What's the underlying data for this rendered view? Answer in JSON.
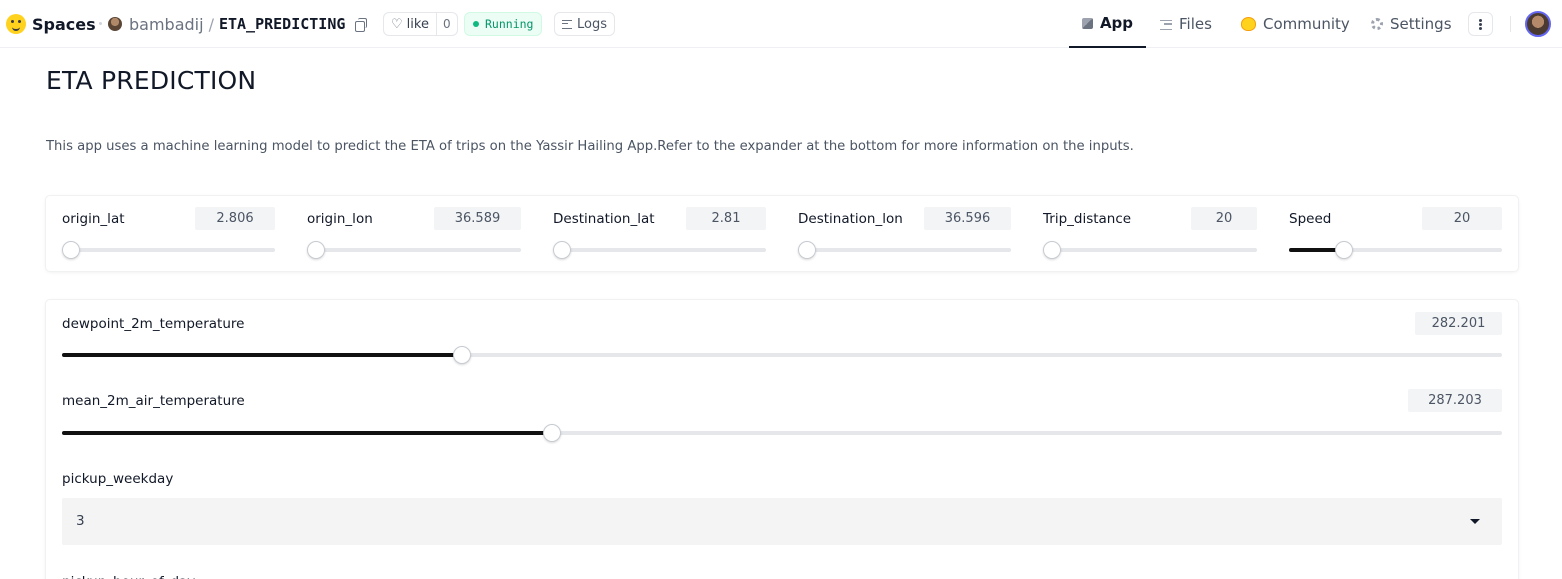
{
  "header": {
    "brand": "Spaces",
    "owner": "bambadij",
    "separator": "/",
    "repo_name": "ETA_PREDICTING",
    "like_label": "like",
    "like_count": "0",
    "status": "Running",
    "logs_label": "Logs",
    "nav": {
      "app": "App",
      "files": "Files",
      "community": "Community",
      "settings": "Settings"
    },
    "colors": {
      "status_green": "#059669",
      "accent_yellow": "#ffd21e"
    }
  },
  "app": {
    "title": "ETA PREDICTION",
    "description": "This app uses a machine learning model to predict the ETA of trips on the Yassir Hailing App.Refer to the expander at the bottom for more information on the inputs.",
    "top_sliders": [
      {
        "label": "origin_lat",
        "value": "2.806",
        "fraction": 0.0
      },
      {
        "label": "origin_lon",
        "value": "36.589",
        "fraction": 0.0
      },
      {
        "label": "Destination_lat",
        "value": "2.81",
        "fraction": 0.0
      },
      {
        "label": "Destination_lon",
        "value": "36.596",
        "fraction": 0.0
      },
      {
        "label": "Trip_distance",
        "value": "20",
        "fraction": 0.0
      },
      {
        "label": "Speed",
        "value": "20",
        "fraction": 0.26
      }
    ],
    "weather_sliders": [
      {
        "label": "dewpoint_2m_temperature",
        "value": "282.201",
        "fraction": 0.278
      },
      {
        "label": "mean_2m_air_temperature",
        "value": "287.203",
        "fraction": 0.34
      }
    ],
    "pickup_weekday": {
      "label": "pickup_weekday",
      "value": "3"
    },
    "next_field_label": "pickup_hour_of_day"
  }
}
